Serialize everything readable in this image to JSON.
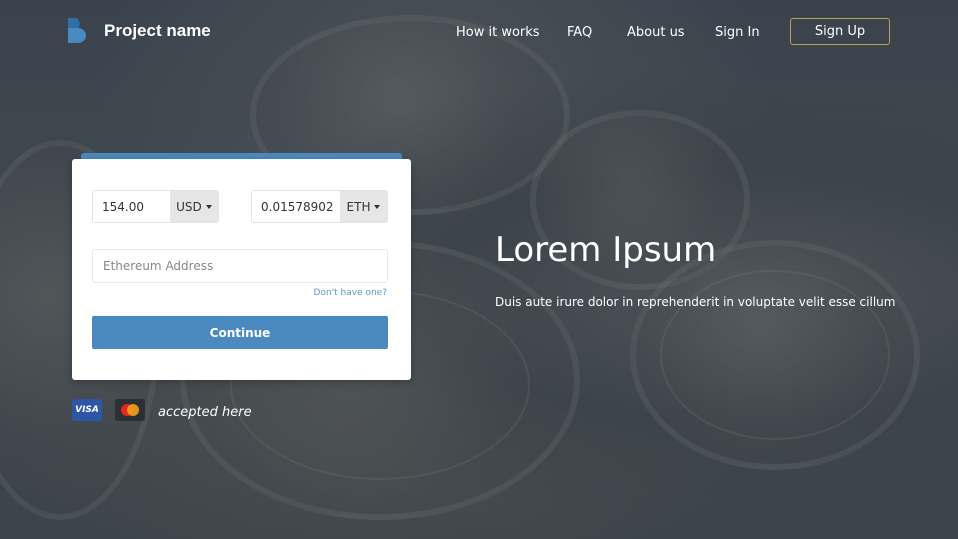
{
  "header": {
    "brand": "Project name",
    "nav": [
      "How it works",
      "FAQ",
      "About us",
      "Sign In"
    ],
    "signup": "Sign Up"
  },
  "form": {
    "fiat_amount": "154.00",
    "fiat_currency": "USD",
    "crypto_amount": "0.01578902",
    "crypto_currency": "ETH",
    "address_placeholder": "Ethereum Address",
    "help_link": "Don't have one?",
    "continue": "Continue"
  },
  "payments": {
    "visa": "VISA",
    "accepted": "accepted here"
  },
  "hero": {
    "title": "Lorem Ipsum",
    "subtitle": "Duis aute irure dolor in reprehenderit in voluptate velit esse cillum"
  },
  "colors": {
    "accent": "#4a8ac0",
    "signup_border": "#b8a255",
    "overlay": "#3a434c"
  }
}
